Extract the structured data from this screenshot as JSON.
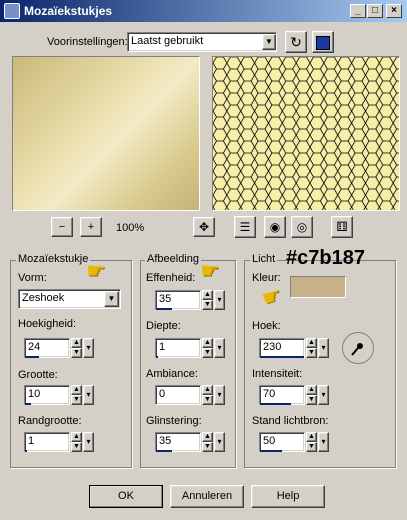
{
  "window": {
    "title": "Mozaïekstukjes",
    "controls": [
      "_",
      "□",
      "×"
    ]
  },
  "presets": {
    "label": "Voorinstellingen:",
    "value": "Laatst gebruikt"
  },
  "zoom": {
    "level": "100%"
  },
  "mosaic": {
    "title": "Mozaïekstukje",
    "shape_label": "Vorm:",
    "shape_value": "Zeshoek",
    "angularity_label": "Hoekigheid:",
    "angularity_value": "24",
    "size_label": "Grootte:",
    "size_value": "10",
    "border_size_label": "Randgrootte:",
    "border_size_value": "1"
  },
  "image": {
    "title": "Afbeelding",
    "smoothness_label": "Effenheid:",
    "smoothness_value": "35",
    "depth_label": "Diepte:",
    "depth_value": "1",
    "ambiance_label": "Ambiance:",
    "ambiance_value": "0",
    "shine_label": "Glinstering:",
    "shine_value": "35"
  },
  "light": {
    "title": "Licht",
    "color_label": "Kleur:",
    "color_hex": "#c7b187",
    "color_annotation": "#c7b187",
    "angle_label": "Hoek:",
    "angle_value": "230",
    "intensity_label": "Intensiteit:",
    "intensity_value": "70",
    "elevation_label": "Stand lichtbron:",
    "elevation_value": "50"
  },
  "buttons": {
    "ok": "OK",
    "cancel": "Annuleren",
    "help": "Help"
  },
  "colors": {
    "titlebar": "#0a246a",
    "face": "#d4d0c8",
    "hex_fill": "#f7efa8",
    "hand": "#e6b800"
  }
}
